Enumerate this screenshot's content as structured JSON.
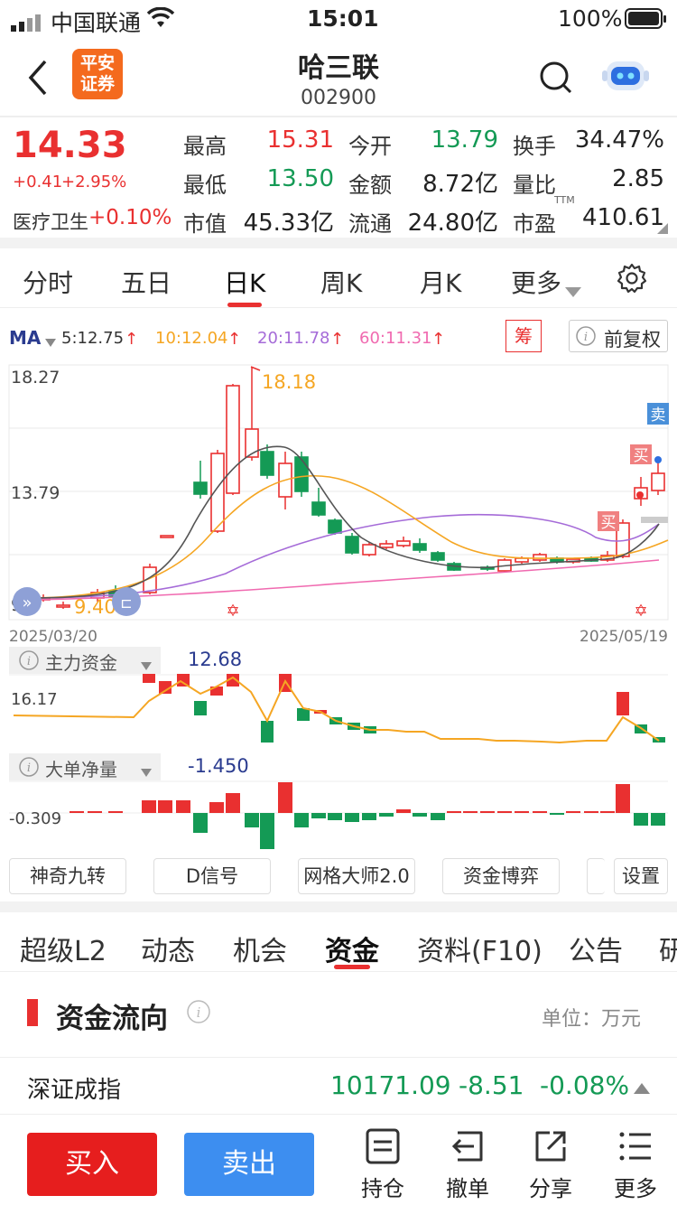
{
  "status": {
    "carrier": "中国联通",
    "time": "15:01",
    "battery": "100%"
  },
  "header": {
    "broker": "平安\n证券",
    "name": "哈三联",
    "code": "002900"
  },
  "quote": {
    "price": "14.33",
    "change": "+0.41",
    "change_pct": "+2.95%",
    "sector_label": "医疗卫生",
    "sector_change": "+0.10%",
    "high_label": "最高",
    "high": "15.31",
    "open_label": "今开",
    "open": "13.79",
    "turnover_label": "换手",
    "turnover": "34.47%",
    "low_label": "最低",
    "low": "13.50",
    "amount_label": "金额",
    "amount": "8.72亿",
    "vol_ratio_label": "量比",
    "vol_ratio": "2.85",
    "mktcap_label": "市值",
    "mktcap": "45.33亿",
    "float_label": "流通",
    "float": "24.80亿",
    "pe_label": "市盈",
    "pe_sup": "TTM",
    "pe": "410.61"
  },
  "chart_tabs": [
    "分时",
    "五日",
    "日K",
    "周K",
    "月K",
    "更多"
  ],
  "active_chart_tab": "日K",
  "ma": {
    "label": "MA",
    "ma5": "5:12.75",
    "ma10": "10:12.04",
    "ma20": "20:11.78",
    "ma60": "60:11.31",
    "chip": "筹",
    "adjust": "前复权"
  },
  "kline": {
    "y_top": "18.27",
    "y_mid": "13.79",
    "y_bottom": "9.3",
    "max_label": "18.18",
    "min_label": "9.40",
    "date_start": "2025/03/20",
    "date_end": "2025/05/19",
    "sell_tag": "卖",
    "buy_tag": "买"
  },
  "main_fund": {
    "title": "主力资金",
    "value": "12.68",
    "axis": "16.17"
  },
  "big_order": {
    "title": "大单净量",
    "value": "-1.450",
    "axis": "-0.309"
  },
  "tool_buttons": [
    "神奇九转",
    "D信号",
    "网格大师2.0",
    "资金博弈",
    "设置"
  ],
  "info_tabs": [
    "超级L2",
    "动态",
    "机会",
    "资金",
    "资料(F10)",
    "公告",
    "研"
  ],
  "active_info_tab": "资金",
  "fund_flow": {
    "title": "资金流向",
    "unit": "单位：万元"
  },
  "index": {
    "name": "深证成指",
    "value": "10171.09",
    "change": "-8.51",
    "pct": "-0.08%"
  },
  "toolbar": {
    "buy": "买入",
    "sell": "卖出",
    "hold": "持仓",
    "cancel": "撤单",
    "share": "分享",
    "more": "更多"
  },
  "colors": {
    "up": "#e93030",
    "down": "#149a55",
    "ma5": "#555555",
    "ma10": "#f5a623",
    "ma20": "#a56bd8",
    "ma60": "#f06ab0",
    "buy_btn": "#e61e1e",
    "sell_btn": "#3d8ef0"
  }
}
